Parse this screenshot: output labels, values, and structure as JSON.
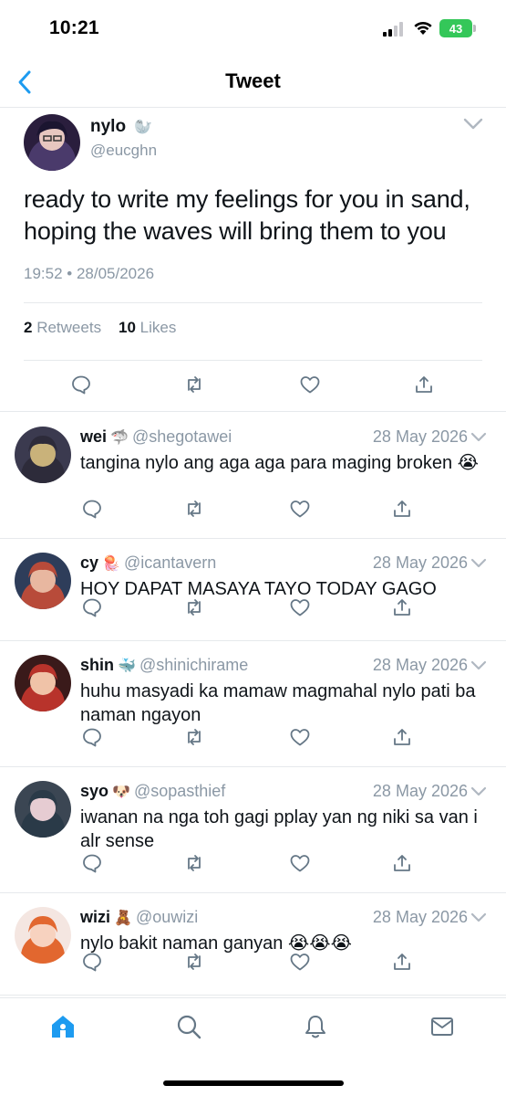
{
  "status_bar": {
    "time": "10:21",
    "battery": "43"
  },
  "nav": {
    "title": "Tweet"
  },
  "main_tweet": {
    "name": "nylo",
    "name_emoji": "🦭",
    "handle": "@eucghn",
    "text": "ready to write my feelings for you in sand, hoping the waves will bring them to you",
    "timestamp": "19:52 • 28/05/2026",
    "retweets_count": "2",
    "retweets_label": "Retweets",
    "likes_count": "10",
    "likes_label": "Likes"
  },
  "replies": [
    {
      "name": "wei",
      "emoji": "🦈",
      "handle": "@shegotawei",
      "date": "28 May 2026",
      "text": "tangina nylo ang aga aga para maging broken 😭"
    },
    {
      "name": "cy",
      "emoji": "🪼",
      "handle": "@icantavern",
      "date": "28 May 2026",
      "text": "HOY DAPAT MASAYA TAYO TODAY GAGO"
    },
    {
      "name": "shin",
      "emoji": "🐳",
      "handle": "@shinichirame",
      "date": "28 May 2026",
      "text": "huhu masyadi ka mamaw magmahal nylo pati ba naman ngayon"
    },
    {
      "name": "syo",
      "emoji": "🐶",
      "handle": "@sopasthief",
      "date": "28 May 2026",
      "text": "iwanan na nga toh gagi pplay yan ng niki sa van i alr sense"
    },
    {
      "name": "wizi",
      "emoji": "🧸",
      "handle": "@ouwizi",
      "date": "28 May 2026",
      "text": "nylo bakit naman ganyan 😭😭😭"
    }
  ],
  "colors": {
    "accent": "#1d9bf0",
    "secondary_text": "#8b98a5",
    "icon_gray": "#657786",
    "divider": "#e6e9ec",
    "battery": "#34c759"
  },
  "icons": {
    "back": "chevron-left-icon",
    "more": "chevron-down-icon",
    "reply": "reply-icon",
    "retweet": "retweet-icon",
    "like": "heart-icon",
    "share": "share-icon",
    "home": "home-icon",
    "search": "search-icon",
    "notifications": "bell-icon",
    "messages": "mail-icon"
  }
}
